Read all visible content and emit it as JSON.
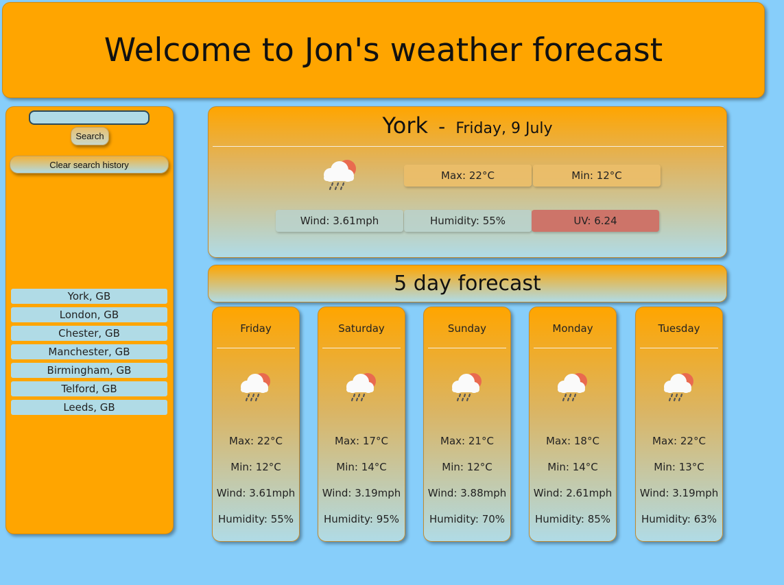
{
  "header": {
    "title": "Welcome to Jon's weather forecast"
  },
  "sidebar": {
    "search": {
      "value": "",
      "placeholder": ""
    },
    "search_label": "Search",
    "clear_label": "Clear search history",
    "history": [
      "York, GB",
      "London, GB",
      "Chester, GB",
      "Manchester, GB",
      "Birmingham, GB",
      "Telford, GB",
      "Leeds, GB"
    ]
  },
  "current": {
    "city": "York",
    "separator": "-",
    "date": "Friday, 9 July",
    "icon": "cloud-rain-sun-icon",
    "max": "Max: 22°C",
    "min": "Min: 12°C",
    "wind": "Wind: 3.61mph",
    "humidity": "Humidity: 55%",
    "uv": "UV: 6.24",
    "uv_color": "#cd7469"
  },
  "forecast": {
    "title": "5 day forecast",
    "days": [
      {
        "name": "Friday",
        "icon": "cloud-rain-sun-icon",
        "max": "Max: 22°C",
        "min": "Min: 12°C",
        "wind": "Wind: 3.61mph",
        "humidity": "Humidity: 55%"
      },
      {
        "name": "Saturday",
        "icon": "cloud-rain-sun-icon",
        "max": "Max: 17°C",
        "min": "Min: 14°C",
        "wind": "Wind: 3.19mph",
        "humidity": "Humidity: 95%"
      },
      {
        "name": "Sunday",
        "icon": "cloud-rain-sun-icon",
        "max": "Max: 21°C",
        "min": "Min: 12°C",
        "wind": "Wind: 3.88mph",
        "humidity": "Humidity: 70%"
      },
      {
        "name": "Monday",
        "icon": "cloud-rain-sun-icon",
        "max": "Max: 18°C",
        "min": "Min: 14°C",
        "wind": "Wind: 2.61mph",
        "humidity": "Humidity: 85%"
      },
      {
        "name": "Tuesday",
        "icon": "cloud-rain-sun-icon",
        "max": "Max: 22°C",
        "min": "Min: 13°C",
        "wind": "Wind: 3.19mph",
        "humidity": "Humidity: 63%"
      }
    ]
  },
  "colors": {
    "background": "#87cefa",
    "panel": "#ffa500",
    "accent_blue": "#b0dbe6"
  }
}
